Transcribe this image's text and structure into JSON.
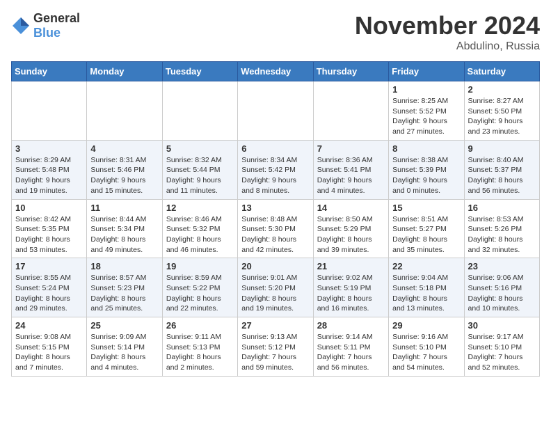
{
  "header": {
    "logo_general": "General",
    "logo_blue": "Blue",
    "month_title": "November 2024",
    "location": "Abdulino, Russia"
  },
  "weekdays": [
    "Sunday",
    "Monday",
    "Tuesday",
    "Wednesday",
    "Thursday",
    "Friday",
    "Saturday"
  ],
  "weeks": [
    [
      {
        "day": "",
        "info": ""
      },
      {
        "day": "",
        "info": ""
      },
      {
        "day": "",
        "info": ""
      },
      {
        "day": "",
        "info": ""
      },
      {
        "day": "",
        "info": ""
      },
      {
        "day": "1",
        "info": "Sunrise: 8:25 AM\nSunset: 5:52 PM\nDaylight: 9 hours\nand 27 minutes."
      },
      {
        "day": "2",
        "info": "Sunrise: 8:27 AM\nSunset: 5:50 PM\nDaylight: 9 hours\nand 23 minutes."
      }
    ],
    [
      {
        "day": "3",
        "info": "Sunrise: 8:29 AM\nSunset: 5:48 PM\nDaylight: 9 hours\nand 19 minutes."
      },
      {
        "day": "4",
        "info": "Sunrise: 8:31 AM\nSunset: 5:46 PM\nDaylight: 9 hours\nand 15 minutes."
      },
      {
        "day": "5",
        "info": "Sunrise: 8:32 AM\nSunset: 5:44 PM\nDaylight: 9 hours\nand 11 minutes."
      },
      {
        "day": "6",
        "info": "Sunrise: 8:34 AM\nSunset: 5:42 PM\nDaylight: 9 hours\nand 8 minutes."
      },
      {
        "day": "7",
        "info": "Sunrise: 8:36 AM\nSunset: 5:41 PM\nDaylight: 9 hours\nand 4 minutes."
      },
      {
        "day": "8",
        "info": "Sunrise: 8:38 AM\nSunset: 5:39 PM\nDaylight: 9 hours\nand 0 minutes."
      },
      {
        "day": "9",
        "info": "Sunrise: 8:40 AM\nSunset: 5:37 PM\nDaylight: 8 hours\nand 56 minutes."
      }
    ],
    [
      {
        "day": "10",
        "info": "Sunrise: 8:42 AM\nSunset: 5:35 PM\nDaylight: 8 hours\nand 53 minutes."
      },
      {
        "day": "11",
        "info": "Sunrise: 8:44 AM\nSunset: 5:34 PM\nDaylight: 8 hours\nand 49 minutes."
      },
      {
        "day": "12",
        "info": "Sunrise: 8:46 AM\nSunset: 5:32 PM\nDaylight: 8 hours\nand 46 minutes."
      },
      {
        "day": "13",
        "info": "Sunrise: 8:48 AM\nSunset: 5:30 PM\nDaylight: 8 hours\nand 42 minutes."
      },
      {
        "day": "14",
        "info": "Sunrise: 8:50 AM\nSunset: 5:29 PM\nDaylight: 8 hours\nand 39 minutes."
      },
      {
        "day": "15",
        "info": "Sunrise: 8:51 AM\nSunset: 5:27 PM\nDaylight: 8 hours\nand 35 minutes."
      },
      {
        "day": "16",
        "info": "Sunrise: 8:53 AM\nSunset: 5:26 PM\nDaylight: 8 hours\nand 32 minutes."
      }
    ],
    [
      {
        "day": "17",
        "info": "Sunrise: 8:55 AM\nSunset: 5:24 PM\nDaylight: 8 hours\nand 29 minutes."
      },
      {
        "day": "18",
        "info": "Sunrise: 8:57 AM\nSunset: 5:23 PM\nDaylight: 8 hours\nand 25 minutes."
      },
      {
        "day": "19",
        "info": "Sunrise: 8:59 AM\nSunset: 5:22 PM\nDaylight: 8 hours\nand 22 minutes."
      },
      {
        "day": "20",
        "info": "Sunrise: 9:01 AM\nSunset: 5:20 PM\nDaylight: 8 hours\nand 19 minutes."
      },
      {
        "day": "21",
        "info": "Sunrise: 9:02 AM\nSunset: 5:19 PM\nDaylight: 8 hours\nand 16 minutes."
      },
      {
        "day": "22",
        "info": "Sunrise: 9:04 AM\nSunset: 5:18 PM\nDaylight: 8 hours\nand 13 minutes."
      },
      {
        "day": "23",
        "info": "Sunrise: 9:06 AM\nSunset: 5:16 PM\nDaylight: 8 hours\nand 10 minutes."
      }
    ],
    [
      {
        "day": "24",
        "info": "Sunrise: 9:08 AM\nSunset: 5:15 PM\nDaylight: 8 hours\nand 7 minutes."
      },
      {
        "day": "25",
        "info": "Sunrise: 9:09 AM\nSunset: 5:14 PM\nDaylight: 8 hours\nand 4 minutes."
      },
      {
        "day": "26",
        "info": "Sunrise: 9:11 AM\nSunset: 5:13 PM\nDaylight: 8 hours\nand 2 minutes."
      },
      {
        "day": "27",
        "info": "Sunrise: 9:13 AM\nSunset: 5:12 PM\nDaylight: 7 hours\nand 59 minutes."
      },
      {
        "day": "28",
        "info": "Sunrise: 9:14 AM\nSunset: 5:11 PM\nDaylight: 7 hours\nand 56 minutes."
      },
      {
        "day": "29",
        "info": "Sunrise: 9:16 AM\nSunset: 5:10 PM\nDaylight: 7 hours\nand 54 minutes."
      },
      {
        "day": "30",
        "info": "Sunrise: 9:17 AM\nSunset: 5:10 PM\nDaylight: 7 hours\nand 52 minutes."
      }
    ]
  ]
}
